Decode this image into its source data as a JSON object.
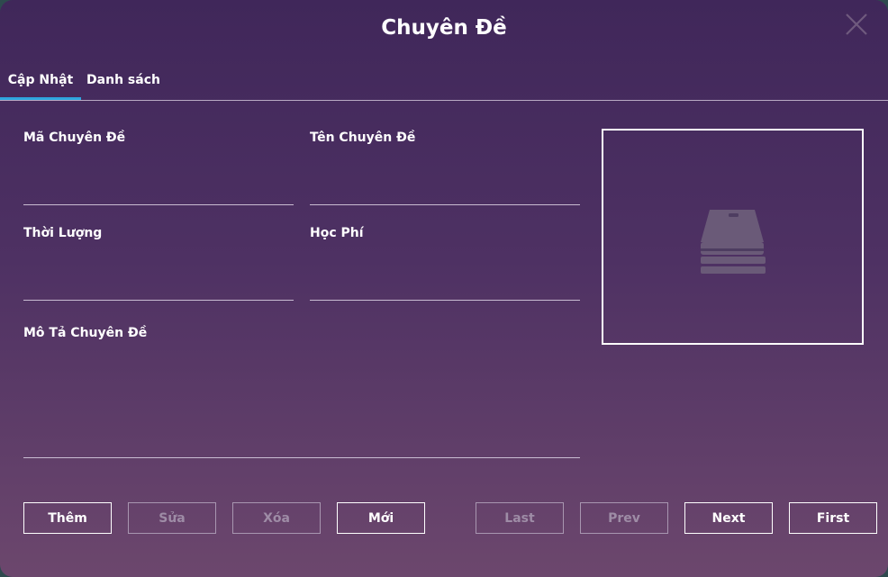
{
  "window": {
    "title": "Chuyên Đề"
  },
  "tabs": [
    {
      "label": "Cập Nhật",
      "active": true
    },
    {
      "label": "Danh sách",
      "active": false
    }
  ],
  "form": {
    "ma_chuyen_de": {
      "label": "Mã Chuyên Đề",
      "value": ""
    },
    "ten_chuyen_de": {
      "label": "Tên Chuyên Đề",
      "value": ""
    },
    "thoi_luong": {
      "label": "Thời Lượng",
      "value": ""
    },
    "hoc_phi": {
      "label": "Học Phí",
      "value": ""
    },
    "mo_ta": {
      "label": "Mô Tả Chuyên Đề",
      "value": ""
    }
  },
  "image": {
    "icon": "book-stack-icon"
  },
  "actions": {
    "them": "Thêm",
    "sua": "Sửa",
    "xoa": "Xóa",
    "moi": "Mới"
  },
  "navigation": {
    "last": "Last",
    "prev": "Prev",
    "next": "Next",
    "first": "First"
  },
  "colors": {
    "accent": "#2fa6df",
    "disabled_text": "#9e8ca6"
  }
}
